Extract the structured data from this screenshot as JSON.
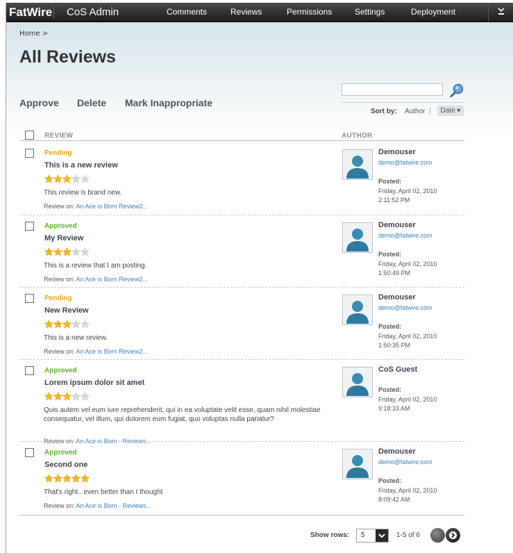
{
  "app": {
    "brand": "FatWire",
    "title": "CoS Admin"
  },
  "nav": [
    "Comments",
    "Reviews",
    "Permissions",
    "Settings",
    "Deployment"
  ],
  "breadcrumb": "Home  >",
  "page_title": "All Reviews",
  "actions": [
    "Approve",
    "Delete",
    "Mark Inappropriate"
  ],
  "search": {
    "value": "",
    "placeholder": ""
  },
  "sort": {
    "label": "Sort by:",
    "author": "Author",
    "date": "Date ▾"
  },
  "columns": {
    "review": "REVIEW",
    "author": "AUTHOR"
  },
  "review_on_label": "Review on:",
  "posted_label": "Posted:",
  "reviews": [
    {
      "status": "Pending",
      "status_color": "#e8a31a",
      "title": "This is a new review",
      "rating": 3,
      "body": "This review is brand new.",
      "review_on": "An Ace is Born Review2...",
      "author": "Demouser",
      "email": "demo@fatwire.com",
      "date": "Friday, April 02, 2010",
      "time": "2:11:52 PM"
    },
    {
      "status": "Approved",
      "status_color": "#5fae2e",
      "title": "My Review",
      "rating": 3,
      "body": "This is a review that I am posting.",
      "review_on": "An Ace is Born Review2...",
      "author": "Demouser",
      "email": "demo@fatwire.com",
      "date": "Friday, April 02, 2010",
      "time": "1:50:49 PM"
    },
    {
      "status": "Pending",
      "status_color": "#e8a31a",
      "title": "New Review",
      "rating": 3,
      "body": "This is a new review.",
      "review_on": "An Ace is Born Review2...",
      "author": "Demouser",
      "email": "demo@fatwire.com",
      "date": "Friday, April 02, 2010",
      "time": "1:50:35 PM"
    },
    {
      "status": "Approved",
      "status_color": "#5fae2e",
      "title": "Lorem ipsum dolor sit amet",
      "rating": 3,
      "body": "Quis autem vel eum iure reprehenderit, qui in ea voluptate velit esse, quam nihil molestiae consequatur, vel illum, qui dolorem eum fugiat, quo voluptas nulla pariatur?",
      "review_on": "An Ace is Born - Reviews...",
      "author": "CoS Guest",
      "email": "",
      "date": "Friday, April 02, 2010",
      "time": "9:18:33 AM"
    },
    {
      "status": "Approved",
      "status_color": "#5fae2e",
      "title": "Second one",
      "rating": 5,
      "body": "That's right.. even better than I thought",
      "review_on": "An Ace is Born - Reviews...",
      "author": "Demouser",
      "email": "demo@fatwire.com",
      "date": "Friday, April 02, 2010",
      "time": "8:09:42 AM"
    }
  ],
  "footer": {
    "show_rows_label": "Show rows:",
    "rows_value": "5",
    "page_info": "1-5 of 6"
  },
  "colors": {
    "star_on": "#f5b81c",
    "star_off": "#d5d8db",
    "link": "#3e7dbb"
  }
}
